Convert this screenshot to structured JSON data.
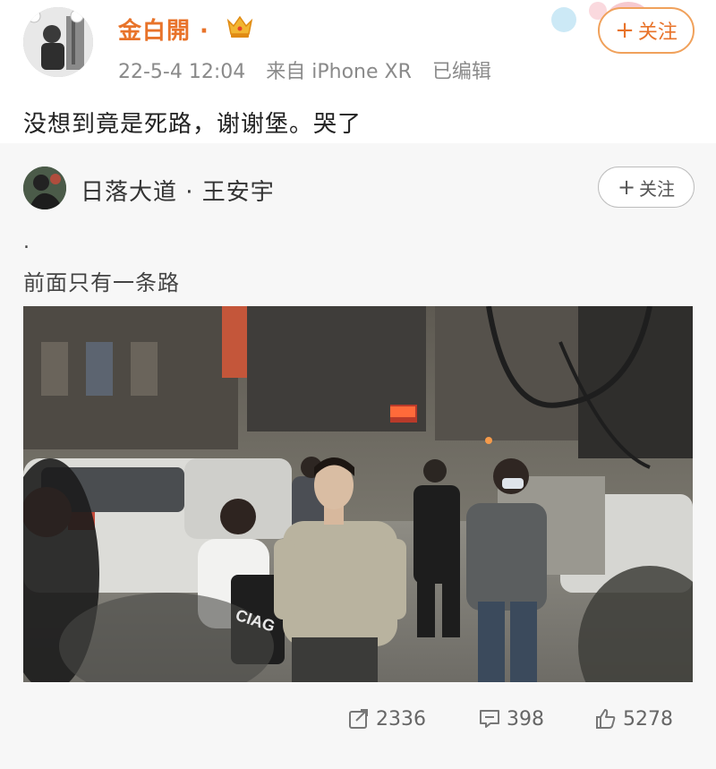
{
  "post": {
    "author": "金白開 ·",
    "meta": {
      "date": "22-5-4 12:04",
      "source": "来自 iPhone XR",
      "edited": "已编辑"
    },
    "follow_label": "关注",
    "text": "没想到竟是死路，谢谢堡。哭了"
  },
  "repost": {
    "author": "日落大道 · 王安宇",
    "follow_label": "关注",
    "dot": ".",
    "text": "前面只有一条路",
    "photo_caption": "CIAG"
  },
  "actions": {
    "reposts": "2336",
    "comments": "398",
    "likes": "5278"
  },
  "icons": {
    "vip": "crown-icon",
    "repost": "share-icon",
    "comment": "comment-icon",
    "like": "thumbs-up-icon"
  },
  "colors": {
    "author_name": "#e8732a",
    "follow_border": "#f0a15b",
    "card_bg": "#f7f7f7",
    "meta_text": "#8a8a8a"
  }
}
